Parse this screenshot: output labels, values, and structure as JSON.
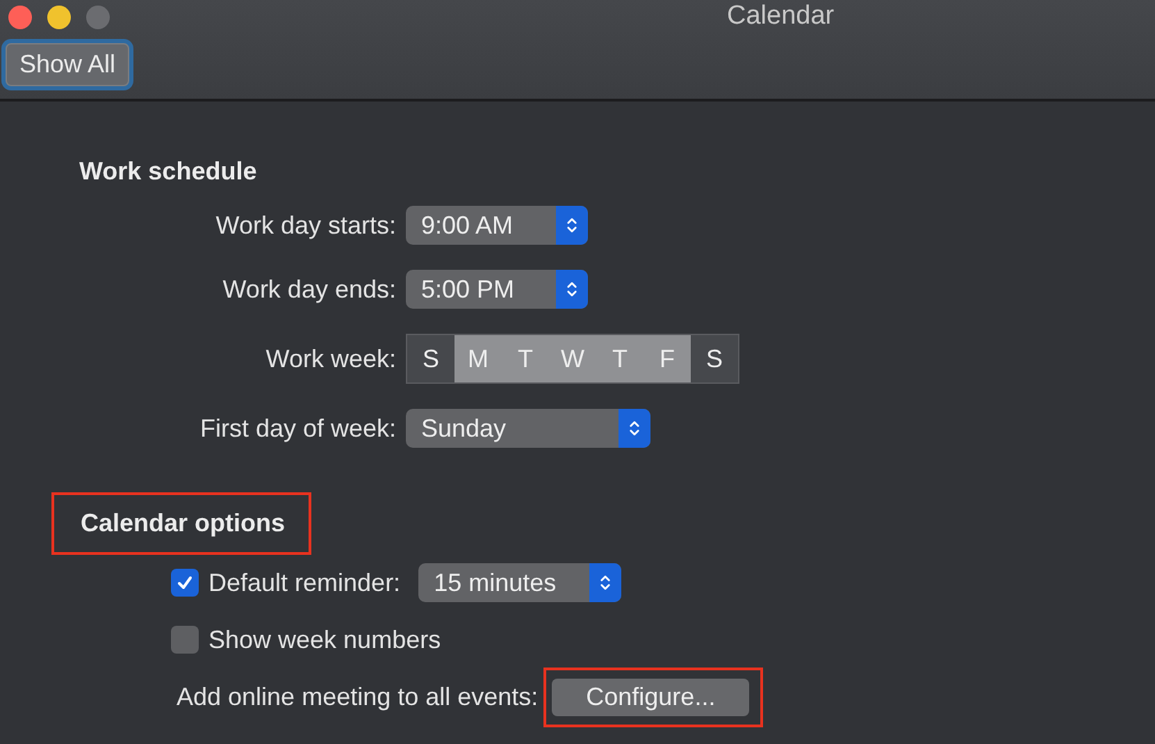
{
  "window": {
    "title": "Calendar"
  },
  "toolbar": {
    "button": {
      "label": "Show All",
      "focused": true
    }
  },
  "work_schedule": {
    "heading": "Work schedule",
    "rows": [
      {
        "kind": "stepper",
        "label": "Work day starts:",
        "value": "9:00 AM"
      },
      {
        "kind": "stepper",
        "label": "Work day ends:",
        "value": "5:00 PM"
      },
      {
        "kind": "days",
        "label": "Work week:",
        "days": [
          {
            "label": "S",
            "selected": false
          },
          {
            "label": "M",
            "selected": true
          },
          {
            "label": "T",
            "selected": true
          },
          {
            "label": "W",
            "selected": true
          },
          {
            "label": "T",
            "selected": true
          },
          {
            "label": "F",
            "selected": true
          },
          {
            "label": "S",
            "selected": false
          }
        ]
      },
      {
        "kind": "popup",
        "label": "First day of week:",
        "value": "Sunday"
      }
    ]
  },
  "calendar_options": {
    "heading": "Calendar options",
    "highlighted": true,
    "default_reminder": {
      "label": "Default reminder:",
      "checked": true,
      "value": "15 minutes"
    },
    "show_week_numbers": {
      "label": "Show week numbers",
      "checked": false
    },
    "online_meeting": {
      "label": "Add online meeting to all events:",
      "button": "Configure...",
      "highlighted": true
    }
  }
}
